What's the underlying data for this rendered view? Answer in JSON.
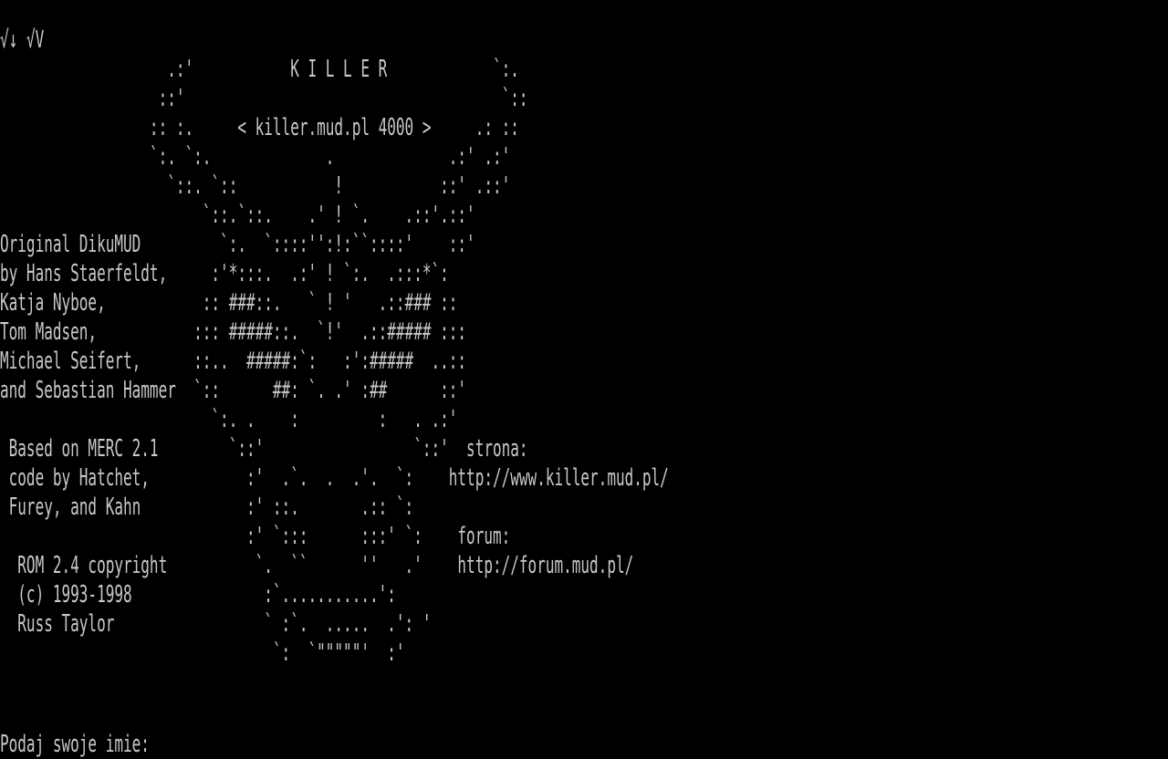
{
  "screen": {
    "title_rows": [
      "√↓ √V",
      "                   .:'           K I L L E R            `:.",
      "                  ::'                                    `::",
      "                 :: :.     < killer.mud.pl 4000 >     .: ::",
      "                 `:. `:.             .             .:' .:'",
      "                   `::. `::           !           ::' .::'",
      "                       `::.`::.    .' ! `.    .::'.::'",
      "Original DikuMUD         `:.  `::::'':!:``::::'    ::'",
      "by Hans Staerfeldt,     :'*:::.  .:' ! `:.  .:::*`:",
      "Katja Nyboe,           :: ###::.   ` ! '   .::### ::",
      "Tom Madsen,           ::: #####::.  `!'  .::##### :::",
      "Michael Seifert,      ::..  #####:`:   :':#####  ..::",
      "and Sebastian Hammer  `::      ##: `. .' :##      ::'",
      "                        `:. .    :         :   . .:'",
      " Based on MERC 2.1        `::'                 `::'  strona:",
      " code by Hatchet,           :'  .`.  .  .'.  `:    http://www.killer.mud.pl/",
      " Furey, and Kahn            :' ::.       .:: `:",
      "                            :' `:::      :::' `:    forum:",
      "  ROM 2.4 copyright          `.  ``      ''   .'    http://forum.mud.pl/",
      "  (c) 1993-1998               :`...........':",
      "  Russ Taylor                 ` :`.  .....  .': '",
      "                               `:  `\"\"\"\"\"'  :'"
    ],
    "prompt": "Podaj swoje imie:"
  },
  "colors": {
    "background": "#000000",
    "foreground": "#c8c8c8"
  }
}
